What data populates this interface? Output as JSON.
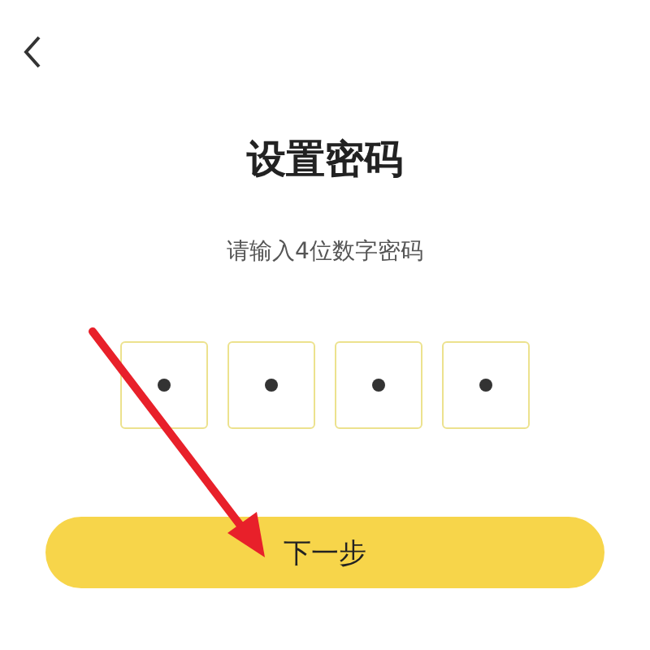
{
  "title": "设置密码",
  "subtitle": "请输入4位数字密码",
  "code_boxes": [
    {
      "filled": true
    },
    {
      "filled": true
    },
    {
      "filled": true
    },
    {
      "filled": true
    }
  ],
  "button": "下一步",
  "annotation": {
    "kind": "arrow"
  }
}
